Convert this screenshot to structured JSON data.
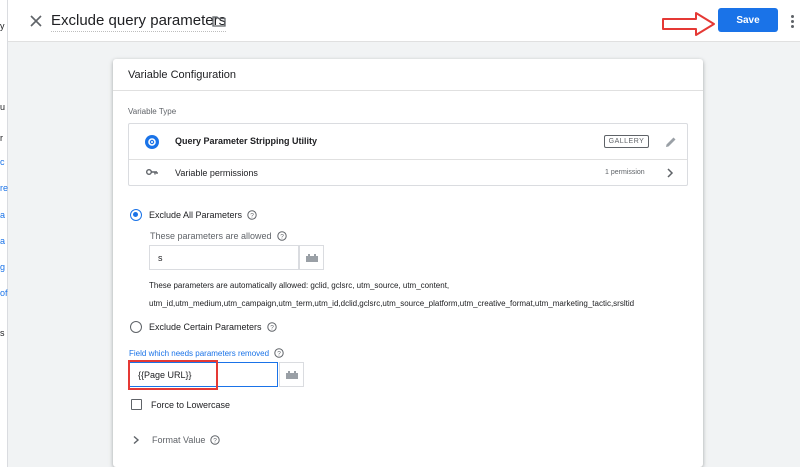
{
  "header": {
    "title": "Exclude query parameters",
    "save_label": "Save",
    "close_icon": "close-icon",
    "folder_icon": "folder-icon",
    "more_icon": "more-vert-icon"
  },
  "colors": {
    "accent": "#1a73e8",
    "annotation": "#e53935"
  },
  "card": {
    "title": "Variable Configuration",
    "variable_type_label": "Variable Type",
    "type_name": "Query Parameter Stripping Utility",
    "gallery_badge": "GALLERY",
    "permissions_label": "Variable permissions",
    "permissions_count": "1 permission"
  },
  "options": {
    "exclude_all_label": "Exclude All Parameters",
    "exclude_all_selected": true,
    "allowed_label": "These parameters are allowed",
    "allowed_value": "s",
    "auto_allowed_line1": "These parameters are automatically allowed: gclid, gclsrc, utm_source, utm_content,",
    "auto_allowed_line2": "utm_id,utm_medium,utm_campaign,utm_term,utm_id,dclid,gclsrc,utm_source_platform,utm_creative_format,utm_marketing_tactic,srsltid",
    "exclude_certain_label": "Exclude Certain Parameters",
    "exclude_certain_selected": false
  },
  "field": {
    "label": "Field which needs parameters removed",
    "value": "{{Page URL}}"
  },
  "lowercase": {
    "label": "Force to Lowercase",
    "checked": false
  },
  "format": {
    "label": "Format Value"
  }
}
